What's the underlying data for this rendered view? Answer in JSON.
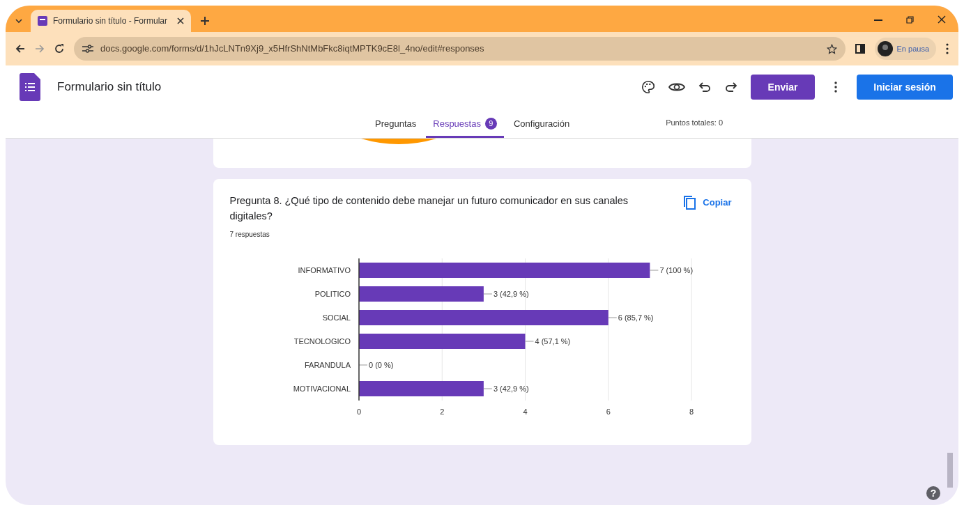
{
  "browser": {
    "tab_title": "Formulario sin título - Formular",
    "url": "docs.google.com/forms/d/1hJcLNTn9Xj9_x5HfrShNtMbFkc8iqtMPTK9cE8l_4no/edit#responses",
    "profile": "En pausa"
  },
  "header": {
    "title": "Formulario sin título",
    "send_button": "Enviar",
    "signin_button": "Iniciar sesión"
  },
  "tabs": [
    {
      "label": "Preguntas",
      "selected": false
    },
    {
      "label": "Respuestas",
      "badge": "9",
      "selected": true
    },
    {
      "label": "Configuración",
      "selected": false
    }
  ],
  "total_points": "Puntos totales: 0",
  "question": {
    "title": "Pregunta 8. ¿Qué tipo de contenido debe manejar un futuro comunicador en sus canales digitales?",
    "copy_button": "Copiar",
    "responses": "7 respuestas",
    "chart_data": {
      "type": "bar",
      "orientation": "horizontal",
      "categories": [
        "INFORMATIVO",
        "POLITICO",
        "SOCIAL",
        "TECNOLOGICO",
        "FARANDULA",
        "MOTIVACIONAL"
      ],
      "values": [
        7,
        3,
        6,
        4,
        0,
        3
      ],
      "value_labels": [
        "7 (100 %)",
        "3 (42,9 %)",
        "6 (85,7 %)",
        "4 (57,1 %)",
        "0 (0 %)",
        "3 (42,9 %)"
      ],
      "xlim": [
        0,
        8
      ],
      "xticks": [
        0,
        2,
        4,
        6,
        8
      ],
      "grid": true
    }
  },
  "help_button": "?"
}
